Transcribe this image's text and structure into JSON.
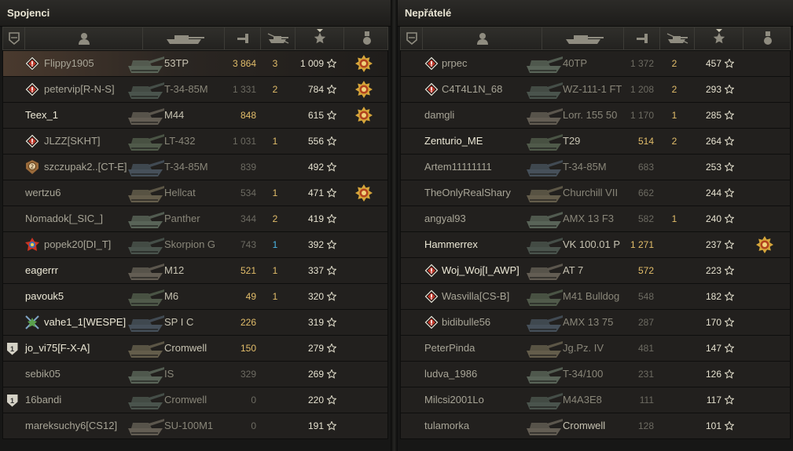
{
  "left_panel": {
    "title": "Spojenci",
    "header_icons": [
      "platoon-icon",
      "player-icon",
      "vehicle-icon",
      "damage-icon",
      "kills-icon",
      "xp-star-icon",
      "medal-icon"
    ],
    "rows": [
      {
        "platoon": "",
        "rank": "diamond",
        "nick": "Flippy1905",
        "vehicle": "53TP",
        "damage": "3 864",
        "kills": "3",
        "xp": "1 009",
        "medal": true,
        "player": true,
        "dim_damage": false,
        "dim_vehicle": false,
        "hi_nick": false
      },
      {
        "platoon": "",
        "rank": "diamond",
        "nick": "petervip[R-N-S]",
        "vehicle": "T-34-85M",
        "damage": "1 331",
        "kills": "2",
        "xp": "784",
        "medal": true,
        "dim_damage": true,
        "dim_vehicle": true
      },
      {
        "platoon": "",
        "rank": "",
        "nick": "Teex_1",
        "vehicle": "M44",
        "damage": "848",
        "kills": "",
        "xp": "615",
        "medal": true,
        "hi_nick": true
      },
      {
        "platoon": "",
        "rank": "diamond",
        "nick": "JLZZ[SKHT]",
        "vehicle": "LT-432",
        "damage": "1 031",
        "kills": "1",
        "xp": "556",
        "dim_damage": true,
        "dim_vehicle": true
      },
      {
        "platoon": "",
        "rank": "bronze",
        "nick": "szczupak2..[CT-E]",
        "vehicle": "T-34-85M",
        "damage": "839",
        "kills": "",
        "xp": "492",
        "dim_damage": true,
        "dim_vehicle": true
      },
      {
        "platoon": "",
        "rank": "",
        "nick": "wertzu6",
        "vehicle": "Hellcat",
        "damage": "534",
        "kills": "1",
        "xp": "471",
        "medal": true,
        "dim_damage": true,
        "dim_vehicle": true
      },
      {
        "platoon": "",
        "rank": "",
        "nick": "Nomadok[_SIC_]",
        "vehicle": "Panther",
        "damage": "344",
        "kills": "2",
        "xp": "419",
        "dim_damage": true,
        "dim_vehicle": true
      },
      {
        "platoon": "",
        "rank": "colorful",
        "nick": "popek20[DI_T]",
        "vehicle": "Skorpion G",
        "damage": "743",
        "kills": "1",
        "xp": "392",
        "blue_kills": true,
        "dim_damage": true,
        "dim_vehicle": true
      },
      {
        "platoon": "",
        "rank": "",
        "nick": "eagerrr",
        "vehicle": "M12",
        "damage": "521",
        "kills": "1",
        "xp": "337",
        "hi_nick": true
      },
      {
        "platoon": "",
        "rank": "",
        "nick": "pavouk5",
        "vehicle": "M6",
        "damage": "49",
        "kills": "1",
        "xp": "320",
        "hi_nick": true
      },
      {
        "platoon": "",
        "rank": "colorful2",
        "nick": "vahe1_1[WESPE]",
        "vehicle": "SP I C",
        "damage": "226",
        "kills": "",
        "xp": "319",
        "hi_nick": true
      },
      {
        "platoon": "1",
        "rank": "",
        "nick": "jo_vi75[F-X-A]",
        "vehicle": "Cromwell",
        "damage": "150",
        "kills": "",
        "xp": "279",
        "hi_nick": true
      },
      {
        "platoon": "",
        "rank": "",
        "nick": "sebik05",
        "vehicle": "IS",
        "damage": "329",
        "kills": "",
        "xp": "269",
        "dim_damage": true,
        "dim_vehicle": true
      },
      {
        "platoon": "1",
        "rank": "",
        "nick": "16bandi",
        "vehicle": "Cromwell",
        "damage": "0",
        "kills": "",
        "xp": "220",
        "dim_damage": true,
        "dim_vehicle": true
      },
      {
        "platoon": "",
        "rank": "",
        "nick": "mareksuchy6[CS12]",
        "vehicle": "SU-100M1",
        "damage": "0",
        "kills": "",
        "xp": "191",
        "dim_damage": true,
        "dim_vehicle": true
      }
    ]
  },
  "right_panel": {
    "title": "Nepřátelé",
    "header_icons": [
      "platoon-icon",
      "player-icon",
      "vehicle-icon",
      "damage-icon",
      "kills-icon",
      "xp-star-icon",
      "medal-icon"
    ],
    "rows": [
      {
        "platoon": "",
        "rank": "diamond",
        "nick": "prpec",
        "vehicle": "40TP",
        "damage": "1 372",
        "kills": "2",
        "xp": "457",
        "dim_damage": true,
        "dim_vehicle": true
      },
      {
        "platoon": "",
        "rank": "diamond",
        "nick": "C4T4L1N_68",
        "vehicle": "WZ-111-1 FT",
        "damage": "1 208",
        "kills": "2",
        "xp": "293",
        "dim_damage": true,
        "dim_vehicle": true
      },
      {
        "platoon": "",
        "rank": "",
        "nick": "damgli",
        "vehicle": "Lorr. 155 50",
        "damage": "1 170",
        "kills": "1",
        "xp": "285",
        "dim_damage": true,
        "dim_vehicle": true
      },
      {
        "platoon": "",
        "rank": "",
        "nick": "Zenturio_ME",
        "vehicle": "T29",
        "damage": "514",
        "kills": "2",
        "xp": "264",
        "hi_nick": true
      },
      {
        "platoon": "",
        "rank": "",
        "nick": "Artem11111111",
        "vehicle": "T-34-85M",
        "damage": "683",
        "kills": "",
        "xp": "253",
        "dim_damage": true,
        "dim_vehicle": true
      },
      {
        "platoon": "",
        "rank": "",
        "nick": "TheOnlyRealShary",
        "vehicle": "Churchill VII",
        "damage": "662",
        "kills": "",
        "xp": "244",
        "dim_damage": true,
        "dim_vehicle": true
      },
      {
        "platoon": "",
        "rank": "",
        "nick": "angyal93",
        "vehicle": "AMX 13 F3",
        "damage": "582",
        "kills": "1",
        "xp": "240",
        "dim_damage": true,
        "dim_vehicle": true
      },
      {
        "platoon": "",
        "rank": "",
        "nick": "Hammerrex",
        "vehicle": "VK 100.01 P",
        "damage": "1 271",
        "kills": "",
        "xp": "237",
        "medal": true,
        "hi_nick": true
      },
      {
        "platoon": "",
        "rank": "diamond",
        "nick": "Woj_Woj[I_AWP]",
        "vehicle": "AT 7",
        "damage": "572",
        "kills": "",
        "xp": "223",
        "hi_nick": true
      },
      {
        "platoon": "",
        "rank": "diamond",
        "nick": "Wasvilla[CS-B]",
        "vehicle": "M41 Bulldog",
        "damage": "548",
        "kills": "",
        "xp": "182",
        "dim_damage": true,
        "dim_vehicle": true
      },
      {
        "platoon": "",
        "rank": "diamond",
        "nick": "bidibulle56",
        "vehicle": "AMX 13 75",
        "damage": "287",
        "kills": "",
        "xp": "170",
        "dim_damage": true,
        "dim_vehicle": true
      },
      {
        "platoon": "",
        "rank": "",
        "nick": "PeterPinda",
        "vehicle": "Jg.Pz. IV",
        "damage": "481",
        "kills": "",
        "xp": "147",
        "dim_damage": true,
        "dim_vehicle": true
      },
      {
        "platoon": "",
        "rank": "",
        "nick": "ludva_1986",
        "vehicle": "T-34/100",
        "damage": "231",
        "kills": "",
        "xp": "126",
        "dim_damage": true,
        "dim_vehicle": true
      },
      {
        "platoon": "",
        "rank": "",
        "nick": "Milcsi2001Lo",
        "vehicle": "M4A3E8",
        "damage": "111",
        "kills": "",
        "xp": "117",
        "dim_damage": true,
        "dim_vehicle": true
      },
      {
        "platoon": "",
        "rank": "",
        "nick": "tulamorka",
        "vehicle": "Cromwell",
        "damage": "128",
        "kills": "",
        "xp": "101",
        "dim_damage": true,
        "dim_vehicle": false
      }
    ]
  },
  "colors": {
    "gold_damage": "#e2bd6a",
    "blue_kills": "#4bb6e6",
    "xp_text": "#e6e2d0",
    "player_row_highlight": "#4a3a2e"
  }
}
